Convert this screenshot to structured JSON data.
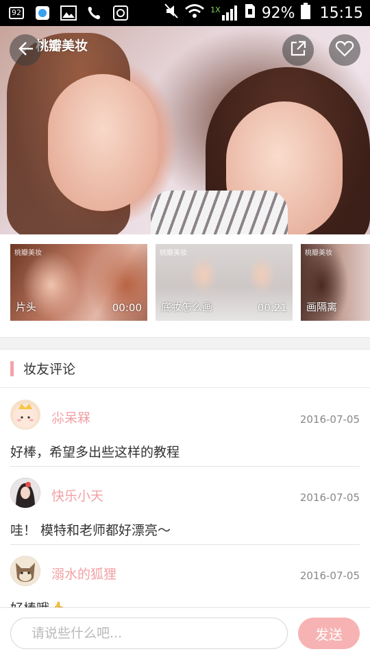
{
  "status_bar": {
    "notification_badge": "92",
    "network": "1X",
    "battery": "92%",
    "time": "15:15"
  },
  "video": {
    "watermark": "桃瓣美妆"
  },
  "chapters": [
    {
      "title": "片头",
      "time": "00:00",
      "logo": "桃瓣美妆"
    },
    {
      "title": "底妆怎么画",
      "time": "00:21",
      "logo": "桃瓣美妆"
    },
    {
      "title": "画隔离",
      "time": "",
      "logo": "桃瓣美妆"
    }
  ],
  "comments_section": {
    "title": "妆友评论"
  },
  "comments": [
    {
      "user": "尛呆槑",
      "date": "2016-07-05",
      "text": "好棒，希望多出些这样的教程"
    },
    {
      "user": "快乐小天",
      "date": "2016-07-05",
      "text": "哇！ 模特和老师都好漂亮～"
    },
    {
      "user": "溺水的狐狸",
      "date": "2016-07-05",
      "text": "好棒哦👍"
    }
  ],
  "input": {
    "placeholder": "请说些什么吧...",
    "value": ""
  },
  "send_button": {
    "label": "发送"
  },
  "colors": {
    "accent_pink": "#f3a0a4",
    "send_button": "#f7b3b3"
  }
}
